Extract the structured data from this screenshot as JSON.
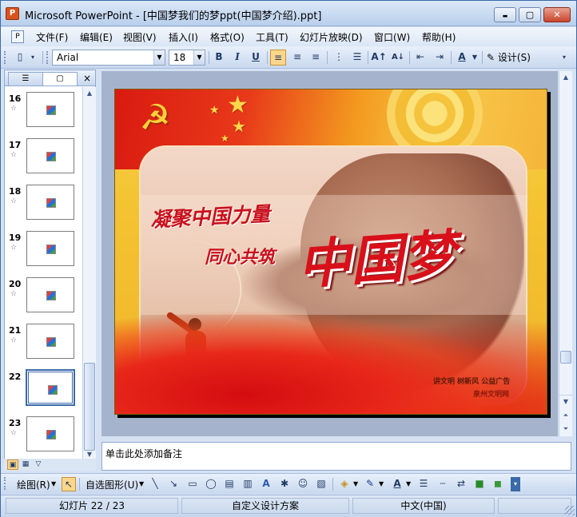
{
  "window": {
    "title": "Microsoft PowerPoint - [中国梦我们的梦ppt(中国梦介绍).ppt]",
    "app_icon": "P",
    "controls": {
      "minimize": "▬",
      "maximize": "▢",
      "close": "✕"
    }
  },
  "menu": {
    "items": [
      "文件(F)",
      "编辑(E)",
      "视图(V)",
      "插入(I)",
      "格式(O)",
      "工具(T)",
      "幻灯片放映(D)",
      "窗口(W)",
      "帮助(H)"
    ]
  },
  "toolbar": {
    "font_name": "Arial",
    "font_size": "18",
    "bold": "B",
    "italic": "I",
    "underline": "U",
    "design_label": "设计(S)"
  },
  "slides_panel": {
    "tab_outline_icon": "outline-icon",
    "tab_slides_icon": "slides-icon",
    "close": "×",
    "slides": [
      {
        "number": "16",
        "selected": false
      },
      {
        "number": "17",
        "selected": false
      },
      {
        "number": "18",
        "selected": false
      },
      {
        "number": "19",
        "selected": false
      },
      {
        "number": "20",
        "selected": false
      },
      {
        "number": "21",
        "selected": false
      },
      {
        "number": "22",
        "selected": true
      },
      {
        "number": "23",
        "selected": false
      }
    ],
    "transition_marker": "☆"
  },
  "slide": {
    "line1": "凝聚中国力量",
    "line2": "同心共筑",
    "big_title": "中国梦",
    "caption1": "讲文明  树新风  公益广告",
    "caption2": "泉州文明网"
  },
  "notes": {
    "placeholder": "单击此处添加备注"
  },
  "drawing_toolbar": {
    "draw_label": "绘图(R)",
    "autoshape_label": "自选图形(U)"
  },
  "status": {
    "slide_position": "幻灯片 22 / 23",
    "design": "自定义设计方案",
    "language": "中文(中国)"
  },
  "colors": {
    "accent_blue": "#3a6aa8",
    "slide_red": "#d8101a",
    "slide_gold": "#f4c332"
  }
}
